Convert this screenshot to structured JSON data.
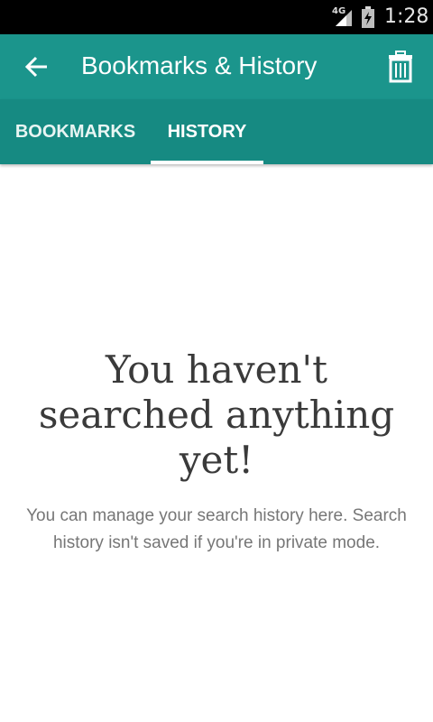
{
  "status_bar": {
    "network": "4G",
    "time": "1:28",
    "icons": [
      "signal-icon",
      "battery-icon"
    ]
  },
  "app_bar": {
    "title": "Bookmarks & History",
    "back_icon": "back-arrow-icon",
    "delete_icon": "trash-icon",
    "color": "#1b958c"
  },
  "tabs": [
    {
      "label": "BOOKMARKS",
      "selected": false
    },
    {
      "label": "HISTORY",
      "selected": true
    }
  ],
  "empty_state": {
    "title": "You haven't searched anything yet!",
    "description": "You can manage your search history here. Search history isn't saved if you're in private mode."
  },
  "colors": {
    "tab_bar": "#168a82",
    "indicator": "#ffffff"
  }
}
